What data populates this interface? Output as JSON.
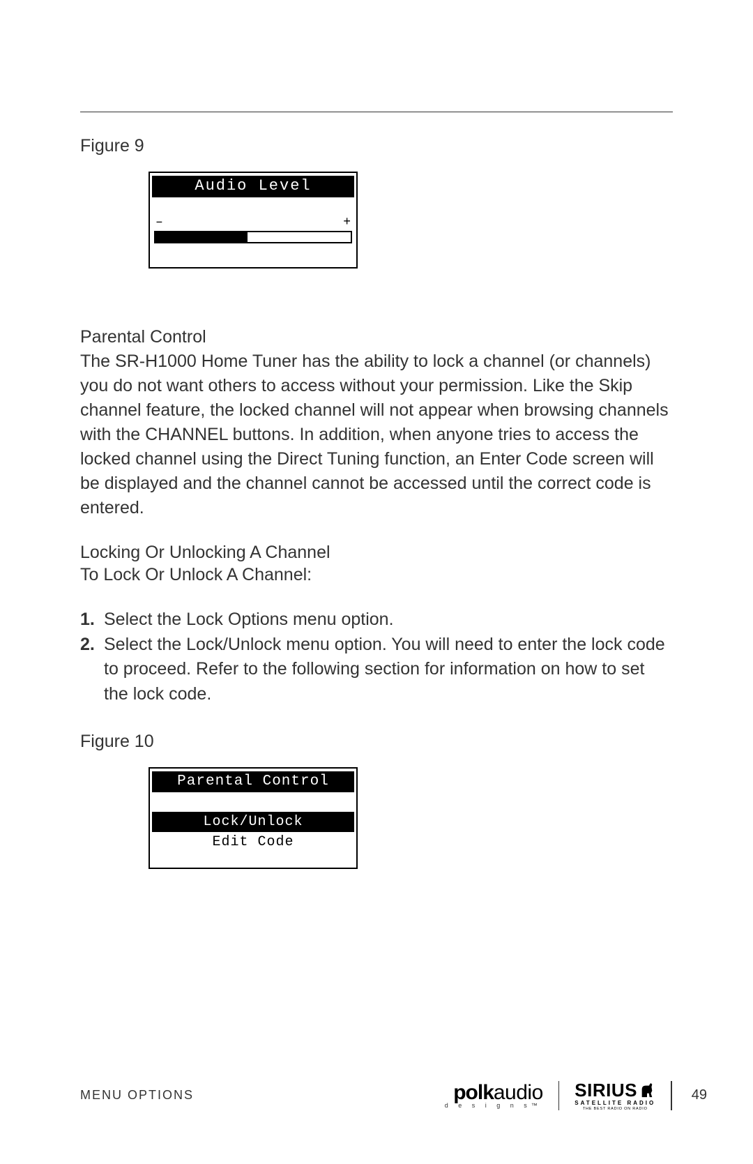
{
  "figure9": {
    "label": "Figure 9",
    "screen": {
      "title": "Audio Level",
      "minus": "–",
      "plus": "+",
      "fill_percent": 47
    }
  },
  "section1": {
    "heading": "Parental Control",
    "body": "The SR-H1000 Home Tuner has the ability to lock a channel (or channels) you do not want others to access without your permission. Like the Skip channel feature, the locked channel will not appear when browsing channels with the CHANNEL buttons. In addition, when anyone tries to access the locked channel using the Direct Tuning function, an Enter Code screen will be displayed and the channel cannot be accessed until the correct code is entered."
  },
  "section2": {
    "heading": "Locking Or Unlocking A Channel",
    "intro": "To Lock Or Unlock A Channel:",
    "steps": [
      {
        "num": "1.",
        "text": "Select the Lock Options menu option."
      },
      {
        "num": "2.",
        "text": "Select the Lock/Unlock menu option. You will need to enter the lock code to proceed. Refer to the following section for information on how to set the lock code."
      }
    ]
  },
  "figure10": {
    "label": "Figure 10",
    "screen": {
      "title": "Parental Control",
      "items": [
        {
          "label": "Lock/Unlock",
          "selected": true
        },
        {
          "label": "Edit Code",
          "selected": false
        }
      ]
    }
  },
  "footer": {
    "section": "MENU OPTIONS",
    "polk_bold": "polk",
    "polk_light": "audio",
    "polk_sub": "d e s i g n s™",
    "sirius": "SIRIUS",
    "sirius_sub": "SATELLITE RADIO",
    "sirius_tag": "THE BEST RADIO ON RADIO",
    "page": "49"
  }
}
